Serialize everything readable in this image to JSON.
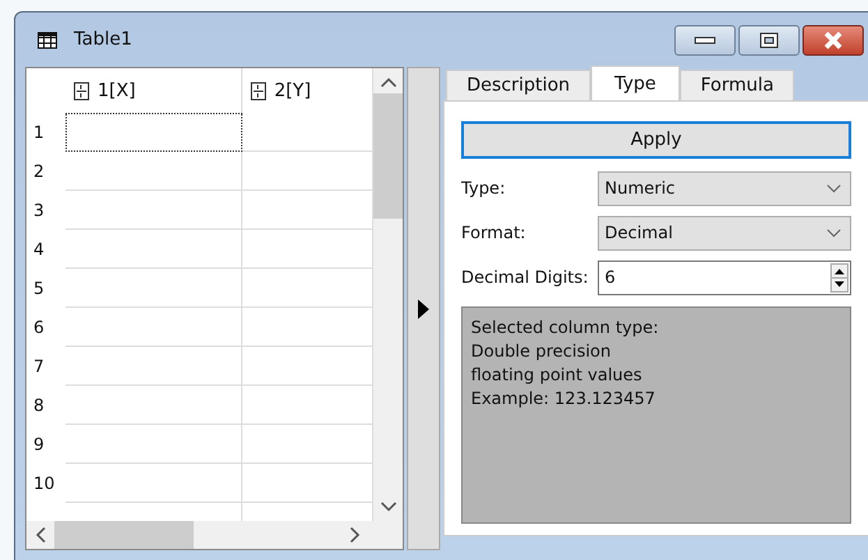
{
  "window": {
    "title": "Table1"
  },
  "table": {
    "columns": [
      {
        "label": "1[X]"
      },
      {
        "label": "2[Y]"
      }
    ],
    "rows": [
      {
        "label": "1",
        "focused": true
      },
      {
        "label": "2",
        "focused": false
      },
      {
        "label": "3",
        "focused": false
      },
      {
        "label": "4",
        "focused": false
      },
      {
        "label": "5",
        "focused": false
      },
      {
        "label": "6",
        "focused": false
      },
      {
        "label": "7",
        "focused": false
      },
      {
        "label": "8",
        "focused": false
      },
      {
        "label": "9",
        "focused": false
      },
      {
        "label": "10",
        "focused": false
      }
    ]
  },
  "tabs": [
    {
      "label": "Description",
      "selected": false
    },
    {
      "label": "Type",
      "selected": true
    },
    {
      "label": "Formula",
      "selected": false
    }
  ],
  "apply_button": {
    "label": "Apply"
  },
  "fields": [
    {
      "kind": "select",
      "label": "Type:",
      "value": "Numeric"
    },
    {
      "kind": "select",
      "label": "Format:",
      "value": "Decimal"
    },
    {
      "kind": "spin",
      "label": "Decimal Digits:",
      "value": "6"
    }
  ],
  "info": {
    "lines": [
      "Selected column type:",
      "Double precision",
      "floating point values",
      "Example: 123.123457"
    ]
  }
}
